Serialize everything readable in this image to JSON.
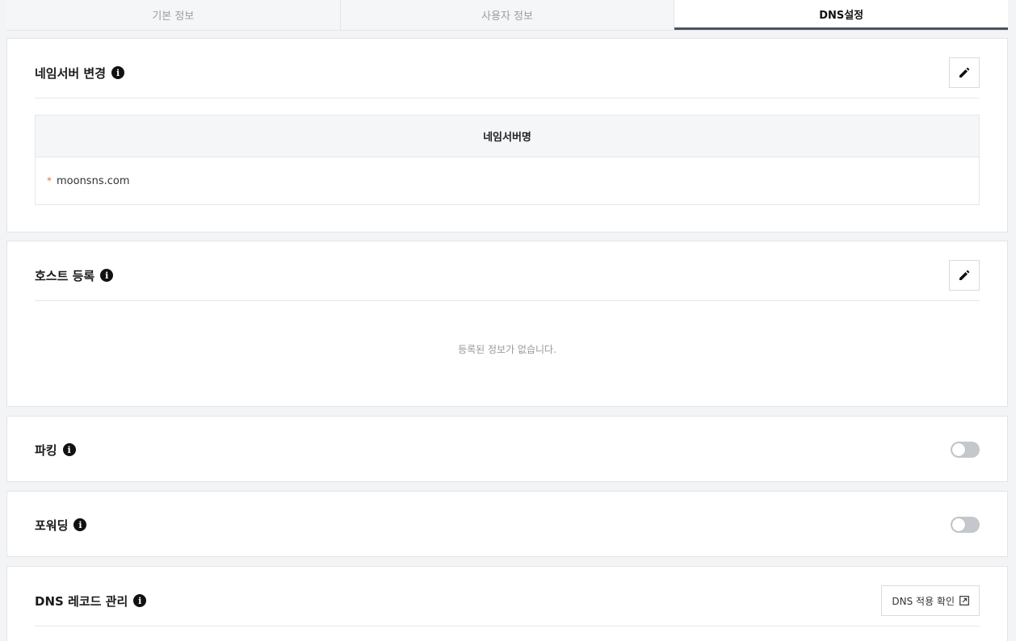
{
  "tabs": [
    {
      "label": "기본 정보",
      "active": false
    },
    {
      "label": "사용자 정보",
      "active": false
    },
    {
      "label": "DNS설정",
      "active": true
    }
  ],
  "nameserver": {
    "title": "네임서버 변경",
    "column_header": "네임서버명",
    "items": [
      "moonsns.com"
    ],
    "bullet": "*",
    "edit_icon": "pencil-icon"
  },
  "host": {
    "title": "호스트 등록",
    "empty_message": "등록된 정보가 없습니다.",
    "edit_icon": "pencil-icon"
  },
  "parking": {
    "title": "파킹",
    "enabled": false
  },
  "forwarding": {
    "title": "포워딩",
    "enabled": false
  },
  "dns_record": {
    "title": "DNS 레코드 관리",
    "check_button_label": "DNS 적용 확인",
    "check_button_icon": "external-link-icon"
  },
  "info_icon_glyph": "i",
  "colors": {
    "active_tab_underline": "#4a5563",
    "bullet": "#e07b39",
    "toggle_off": "#c4c7cb"
  }
}
